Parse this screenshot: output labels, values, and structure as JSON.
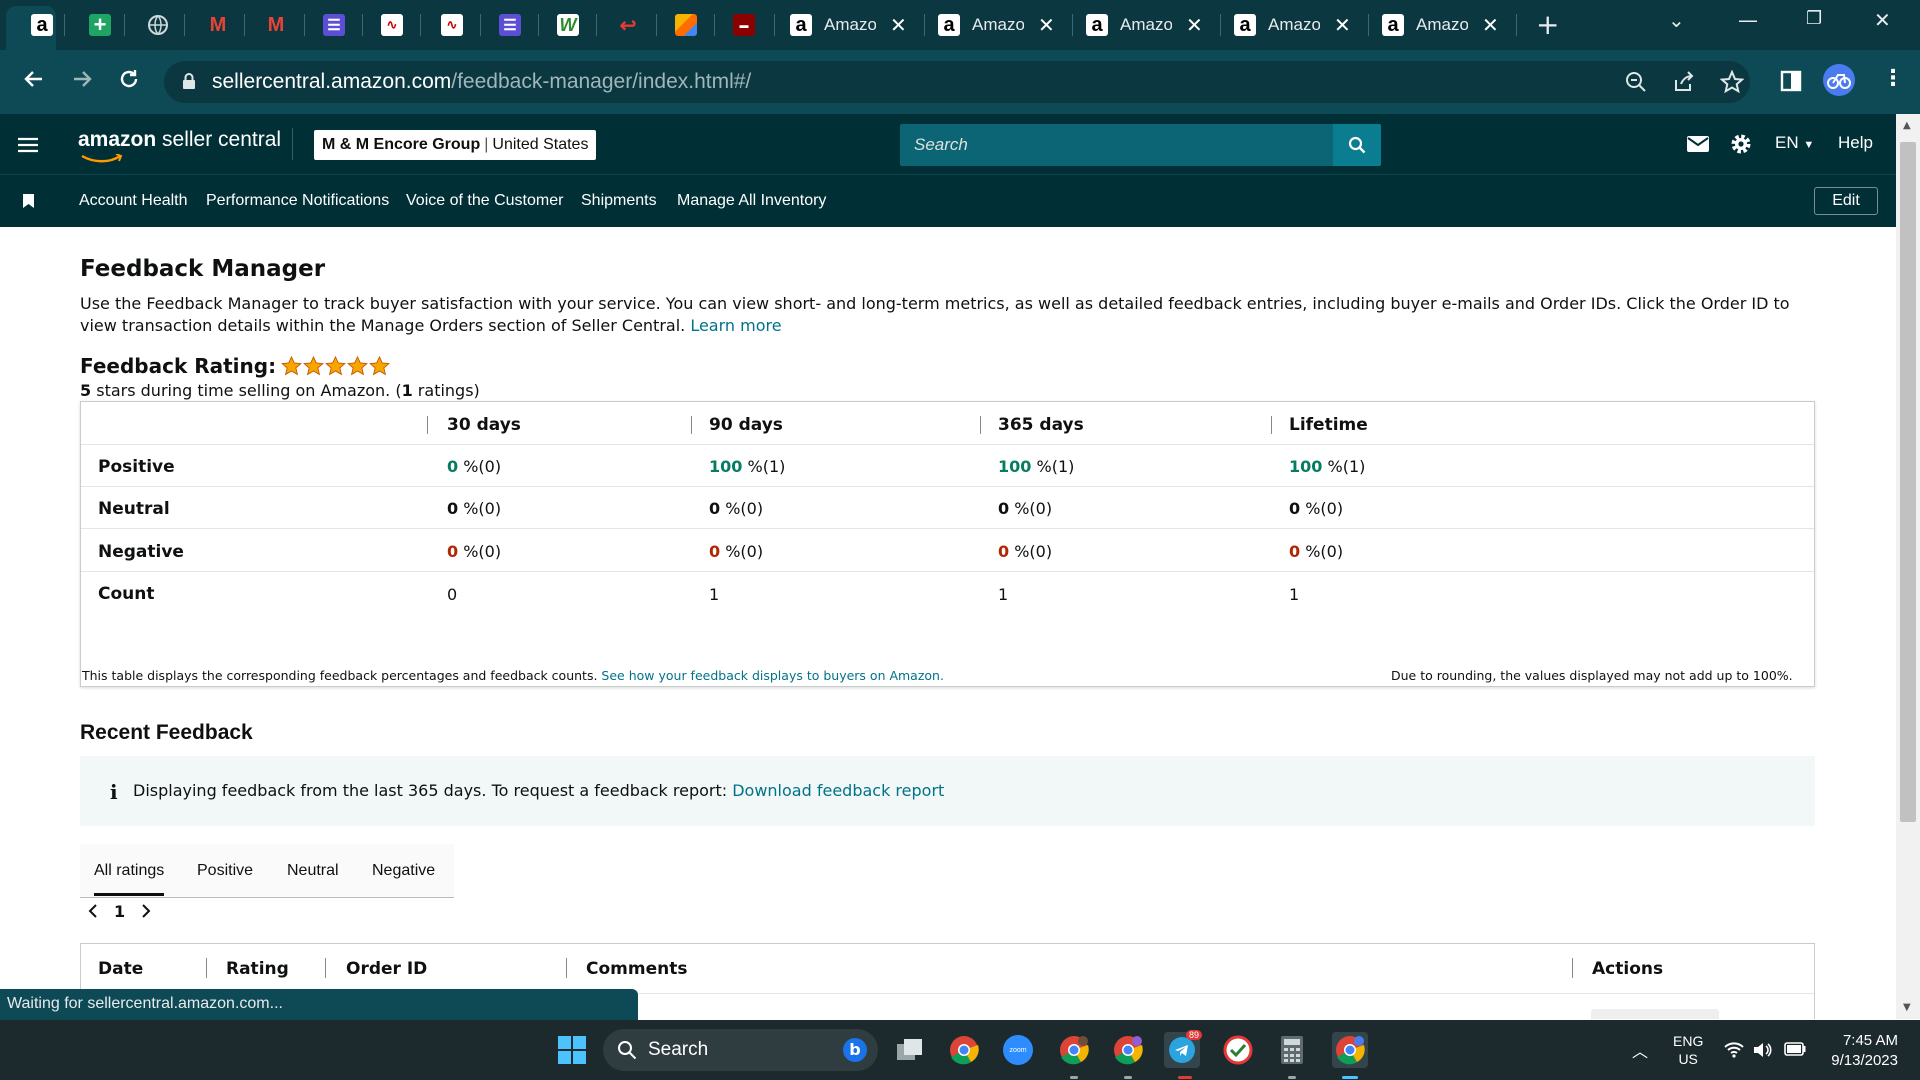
{
  "browser": {
    "tabs": [
      {
        "title": "Amazon"
      },
      {
        "title": "Amazon"
      },
      {
        "title": "Amazon"
      },
      {
        "title": "Amazon"
      },
      {
        "title": "Amazon"
      }
    ],
    "url_host": "sellercentral.amazon.com",
    "url_path": "/feedback-manager/index.html#/",
    "status_text": "Waiting for sellercentral.amazon.com..."
  },
  "header": {
    "logo_brand": "amazon",
    "logo_product": " seller central",
    "store_name": "M & M Encore Group",
    "store_sep": "|",
    "store_region": "United States",
    "search_placeholder": "Search",
    "language": "EN",
    "help": "Help"
  },
  "nav": {
    "links": [
      "Account Health",
      "Performance Notifications",
      "Voice of the Customer",
      "Shipments",
      "Manage All Inventory"
    ],
    "edit": "Edit"
  },
  "page": {
    "title": "Feedback Manager",
    "intro": "Use the Feedback Manager to track buyer satisfaction with your service. You can view short- and long-term metrics, as well as detailed feedback entries, including buyer e-mails and Order IDs. Click the Order ID to view transaction details within the Manage Orders section of Seller Central. ",
    "learn_more": "Learn more",
    "rating_title": "Feedback Rating:",
    "rating_stars": 5,
    "rating_sub_num": "5",
    "rating_sub_text": " stars during time selling on Amazon. (",
    "rating_sub_count": "1",
    "rating_sub_end": " ratings)"
  },
  "summary": {
    "columns": [
      "30 days",
      "90 days",
      "365 days",
      "Lifetime"
    ],
    "rows": [
      {
        "label": "Positive",
        "cells": [
          {
            "v": "0",
            "s": " %(0)"
          },
          {
            "v": "100",
            "s": " %(1)"
          },
          {
            "v": "100",
            "s": " %(1)"
          },
          {
            "v": "100",
            "s": " %(1)"
          }
        ]
      },
      {
        "label": "Neutral",
        "cells": [
          {
            "v": "0",
            "s": " %(0)"
          },
          {
            "v": "0",
            "s": " %(0)"
          },
          {
            "v": "0",
            "s": " %(0)"
          },
          {
            "v": "0",
            "s": " %(0)"
          }
        ]
      },
      {
        "label": "Negative",
        "cells": [
          {
            "v": "0",
            "s": " %(0)"
          },
          {
            "v": "0",
            "s": " %(0)"
          },
          {
            "v": "0",
            "s": " %(0)"
          },
          {
            "v": "0",
            "s": " %(0)"
          }
        ]
      },
      {
        "label": "Count",
        "cells": [
          {
            "v": "0",
            "s": ""
          },
          {
            "v": "1",
            "s": ""
          },
          {
            "v": "1",
            "s": ""
          },
          {
            "v": "1",
            "s": ""
          }
        ]
      }
    ],
    "note": "This table displays the corresponding feedback percentages and feedback counts. ",
    "note_link": "See how your feedback displays to buyers on Amazon.",
    "rounding_note": "Due to rounding, the values displayed may not add up to 100%."
  },
  "recent": {
    "title": "Recent Feedback",
    "info_text": "Displaying feedback from the last 365 days. To request a feedback report: ",
    "info_link": "Download feedback report",
    "tabs": [
      "All ratings",
      "Positive",
      "Neutral",
      "Negative"
    ],
    "page": "1",
    "columns": [
      "Date",
      "Rating",
      "Order ID",
      "Comments",
      "Actions"
    ]
  },
  "taskbar": {
    "search": "Search",
    "telegram_badge": "89",
    "lang_top": "ENG",
    "lang_bottom": "US",
    "time": "7:45 AM",
    "date": "9/13/2023"
  },
  "colors": {
    "positive": "#067d62",
    "negative": "#b12704",
    "header": "#002f36",
    "link": "#00738a",
    "star": "#f7a600"
  }
}
